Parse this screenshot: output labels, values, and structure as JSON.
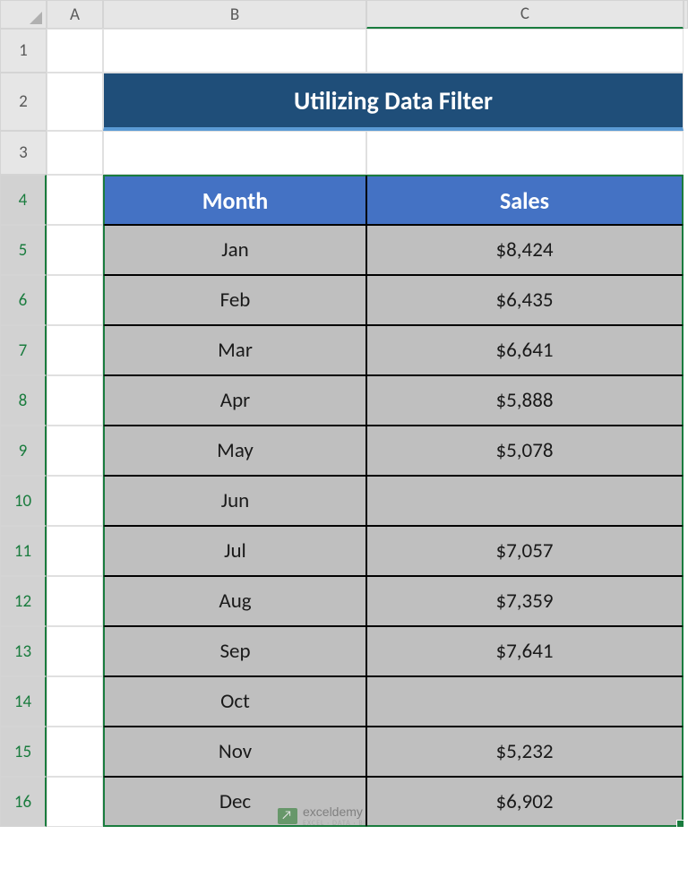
{
  "columns": {
    "a": "A",
    "b": "B",
    "c": "C"
  },
  "rows": [
    "1",
    "2",
    "3",
    "4",
    "5",
    "6",
    "7",
    "8",
    "9",
    "10",
    "11",
    "12",
    "13",
    "14",
    "15",
    "16"
  ],
  "title": "Utilizing Data Filter",
  "headers": {
    "month": "Month",
    "sales": "Sales"
  },
  "data": [
    {
      "month": "Jan",
      "sales": "$8,424"
    },
    {
      "month": "Feb",
      "sales": "$6,435"
    },
    {
      "month": "Mar",
      "sales": "$6,641"
    },
    {
      "month": "Apr",
      "sales": "$5,888"
    },
    {
      "month": "May",
      "sales": "$5,078"
    },
    {
      "month": "Jun",
      "sales": ""
    },
    {
      "month": "Jul",
      "sales": "$7,057"
    },
    {
      "month": "Aug",
      "sales": "$7,359"
    },
    {
      "month": "Sep",
      "sales": "$7,641"
    },
    {
      "month": "Oct",
      "sales": ""
    },
    {
      "month": "Nov",
      "sales": "$5,232"
    },
    {
      "month": "Dec",
      "sales": "$6,902"
    }
  ],
  "watermark": {
    "main": "exceldemy",
    "sub": "EXCEL · DATA · BI"
  }
}
